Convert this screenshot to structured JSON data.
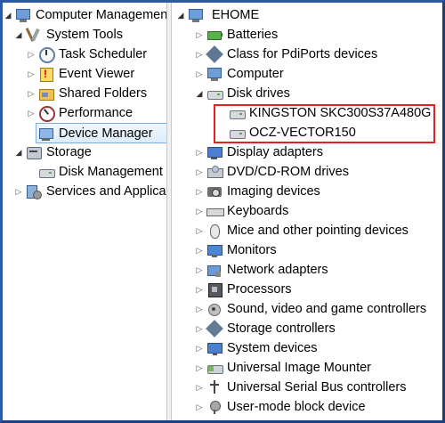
{
  "left_tree": {
    "root": {
      "label": "Computer Management (Local)",
      "icon": "computer-management-icon"
    },
    "system_tools": {
      "label": "System Tools",
      "icon": "system-tools-icon"
    },
    "task_scheduler": {
      "label": "Task Scheduler",
      "icon": "task-scheduler-icon"
    },
    "event_viewer": {
      "label": "Event Viewer",
      "icon": "event-viewer-icon"
    },
    "shared_folders": {
      "label": "Shared Folders",
      "icon": "shared-folders-icon"
    },
    "performance": {
      "label": "Performance",
      "icon": "performance-icon"
    },
    "device_manager": {
      "label": "Device Manager",
      "icon": "device-manager-icon"
    },
    "storage": {
      "label": "Storage",
      "icon": "storage-icon"
    },
    "disk_management": {
      "label": "Disk Management",
      "icon": "disk-management-icon"
    },
    "services_apps": {
      "label": "Services and Applications",
      "icon": "services-and-applications-icon"
    }
  },
  "right_tree": {
    "root": {
      "label": "EHOME",
      "icon": "computer-icon"
    },
    "categories": [
      {
        "label": "Batteries",
        "icon": "battery-icon"
      },
      {
        "label": "Class for PdiPorts devices",
        "icon": "class-device-icon"
      },
      {
        "label": "Computer",
        "icon": "computer-icon"
      },
      {
        "label": "Disk drives",
        "icon": "disk-drives-icon"
      },
      {
        "label": "Display adapters",
        "icon": "display-adapter-icon"
      },
      {
        "label": "DVD/CD-ROM drives",
        "icon": "dvd-drive-icon"
      },
      {
        "label": "Imaging devices",
        "icon": "imaging-device-icon"
      },
      {
        "label": "Keyboards",
        "icon": "keyboard-icon"
      },
      {
        "label": "Mice and other pointing devices",
        "icon": "mouse-icon"
      },
      {
        "label": "Monitors",
        "icon": "monitor-icon"
      },
      {
        "label": "Network adapters",
        "icon": "network-adapter-icon"
      },
      {
        "label": "Processors",
        "icon": "processor-icon"
      },
      {
        "label": "Sound, video and game controllers",
        "icon": "sound-controller-icon"
      },
      {
        "label": "Storage controllers",
        "icon": "storage-controller-icon"
      },
      {
        "label": "System devices",
        "icon": "system-device-icon"
      },
      {
        "label": "Universal Image Mounter",
        "icon": "image-mounter-icon"
      },
      {
        "label": "Universal Serial Bus controllers",
        "icon": "usb-icon"
      },
      {
        "label": "User-mode block device",
        "icon": "user-mode-block-device-icon"
      }
    ],
    "disk_drives": [
      {
        "label": "KINGSTON SKC300S37A480G",
        "icon": "disk-drive-icon"
      },
      {
        "label": "OCZ-VECTOR150",
        "icon": "disk-drive-icon"
      }
    ]
  },
  "colors": {
    "highlight": "#e42121",
    "frame": "#2c59a8",
    "selection": "#dcecfc"
  }
}
